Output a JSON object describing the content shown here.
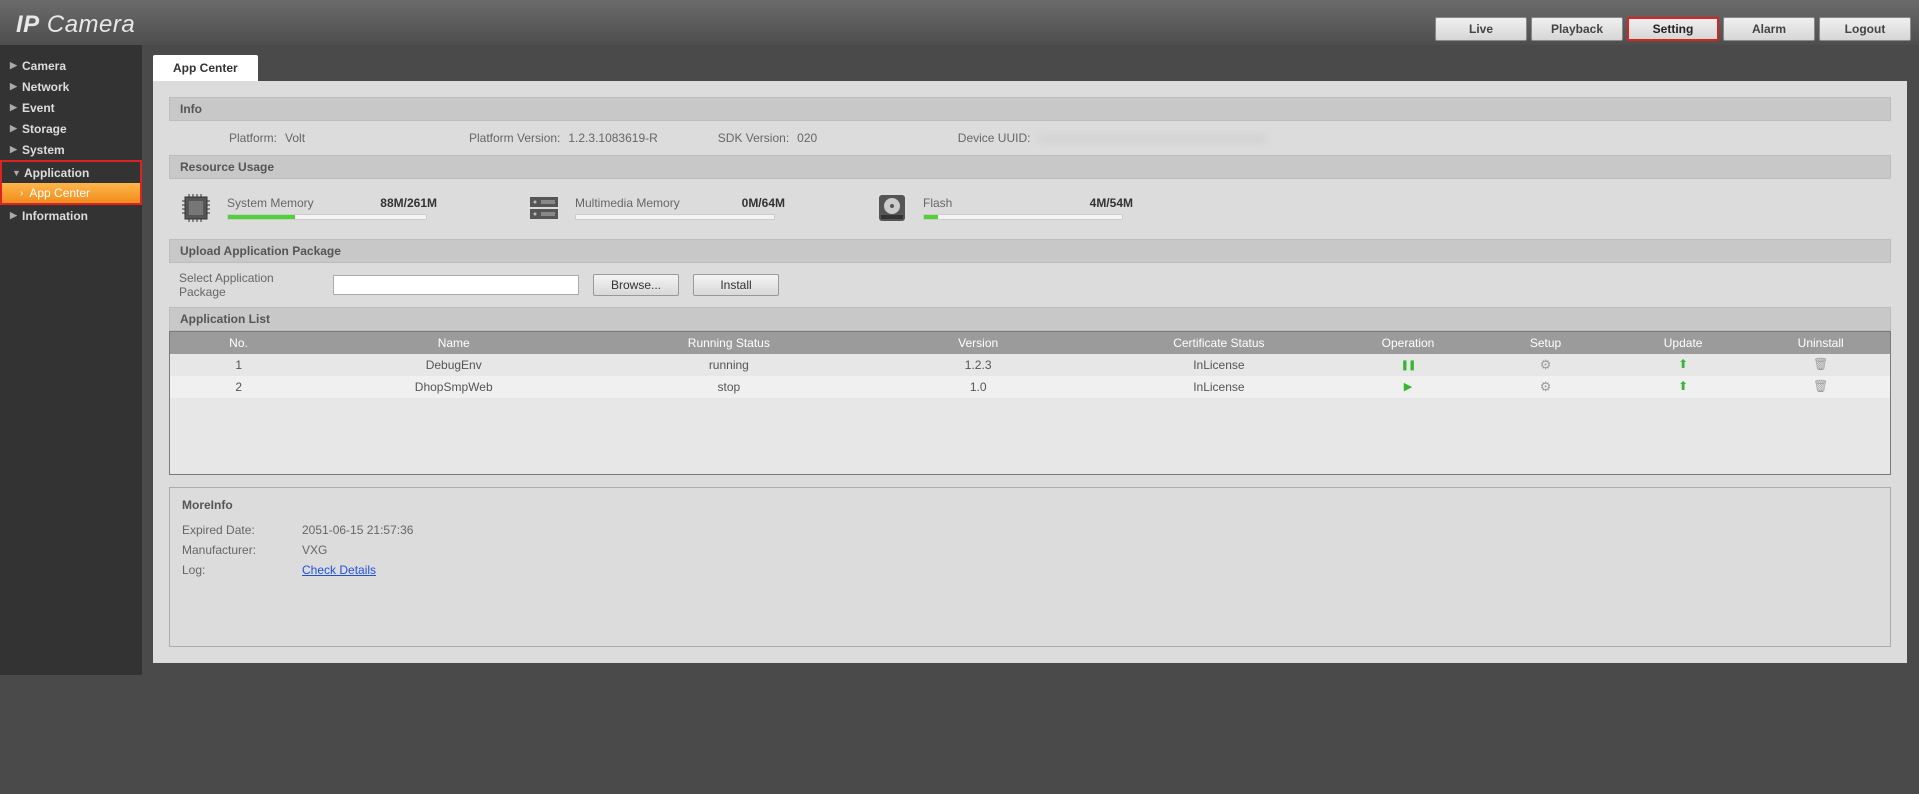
{
  "logo": {
    "bold": "IP",
    "thin": "Camera"
  },
  "topnav": [
    "Live",
    "Playback",
    "Setting",
    "Alarm",
    "Logout"
  ],
  "topnav_active": 2,
  "sidebar": {
    "items": [
      "Camera",
      "Network",
      "Event",
      "Storage",
      "System",
      "Application",
      "Information"
    ],
    "active_group": 5,
    "sub_label": "App Center"
  },
  "tab": {
    "label": "App Center"
  },
  "info": {
    "title": "Info",
    "platform_label": "Platform:",
    "platform": "Volt",
    "pv_label": "Platform Version:",
    "platform_version": "1.2.3.1083619-R",
    "sdk_label": "SDK Version:",
    "sdk_version": "020",
    "uuid_label": "Device UUID:",
    "uuid_blur": "xxxxxxxxxxxxxxxxxxxxxxxxxxxxxxxxxxxxxx"
  },
  "resource": {
    "title": "Resource Usage",
    "sysmem_label": "System Memory",
    "sysmem_val": "88M/261M",
    "sysmem_pct": 34,
    "mmmem_label": "Multimedia Memory",
    "mmmem_val": "0M/64M",
    "mmmem_pct": 0,
    "flash_label": "Flash",
    "flash_val": "4M/54M",
    "flash_pct": 7
  },
  "upload": {
    "title": "Upload Application Package",
    "label": "Select Application Package",
    "browse": "Browse...",
    "install": "Install"
  },
  "applist": {
    "title": "Application List",
    "headers": [
      "No.",
      "Name",
      "Running Status",
      "Version",
      "Certificate Status",
      "Operation",
      "Setup",
      "Update",
      "Uninstall"
    ],
    "rows": [
      {
        "no": "1",
        "name": "DebugEnv",
        "status": "running",
        "version": "1.2.3",
        "cert": "InLicense",
        "op": "pause"
      },
      {
        "no": "2",
        "name": "DhopSmpWeb",
        "status": "stop",
        "version": "1.0",
        "cert": "InLicense",
        "op": "play"
      }
    ]
  },
  "moreinfo": {
    "title": "MoreInfo",
    "expired_label": "Expired Date:",
    "expired": "2051-06-15 21:57:36",
    "manu_label": "Manufacturer:",
    "manu": "VXG",
    "log_label": "Log:",
    "log_link": "Check Details"
  }
}
